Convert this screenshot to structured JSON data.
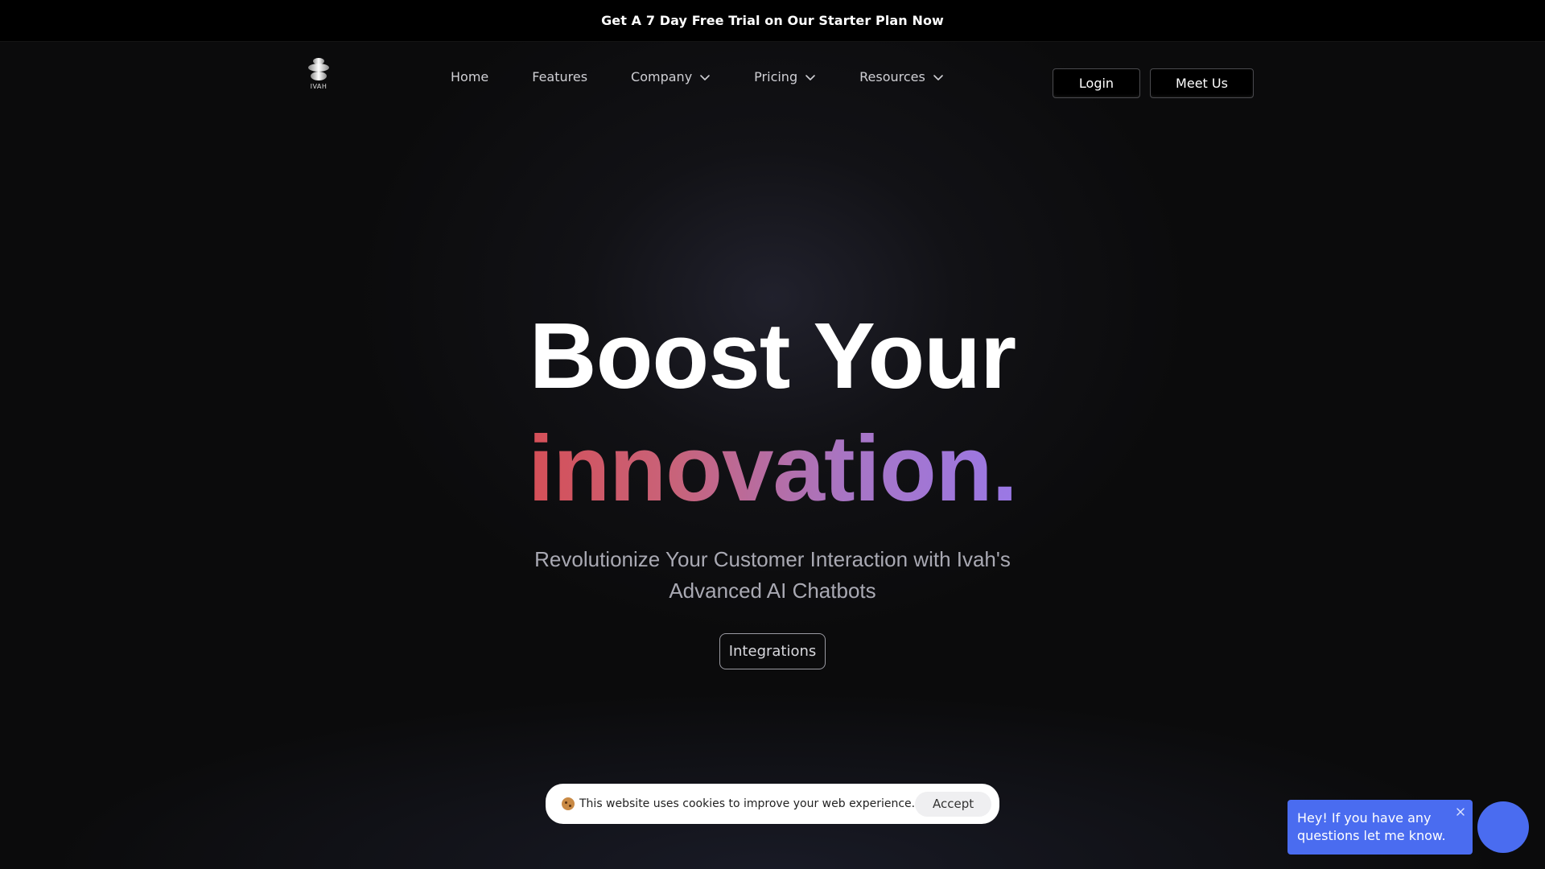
{
  "promo": {
    "text": "Get A 7 Day Free Trial on Our Starter Plan Now"
  },
  "header": {
    "logo_text": "IVAH",
    "nav": [
      {
        "label": "Home",
        "icon": null
      },
      {
        "label": "Features",
        "icon": null
      },
      {
        "label": "Company",
        "icon": "chevron-down-icon"
      },
      {
        "label": "Pricing",
        "icon": "chevron-down-icon"
      },
      {
        "label": "Resources",
        "icon": "chevron-down-icon"
      }
    ],
    "login_label": "Login",
    "meet_label": "Meet Us"
  },
  "hero": {
    "line1": "Boost Your",
    "line2": "innovation.",
    "subtitle_line1": "Revolutionize Your Customer Interaction with Ivah's",
    "subtitle_line2": "Advanced AI Chatbots",
    "cta_label": "Integrations"
  },
  "cookie": {
    "icon": "cookie-icon",
    "text": "This website uses cookies to improve your web experience.",
    "accept_label": "Accept"
  },
  "chat": {
    "message_line1": "Hey! If you have any",
    "message_line2": "questions let me know.",
    "accent_color": "#4a6cf0"
  },
  "colors": {
    "background": "#0b0b0c",
    "gradient_start": "#d54f57",
    "gradient_end": "#9a78e6"
  }
}
